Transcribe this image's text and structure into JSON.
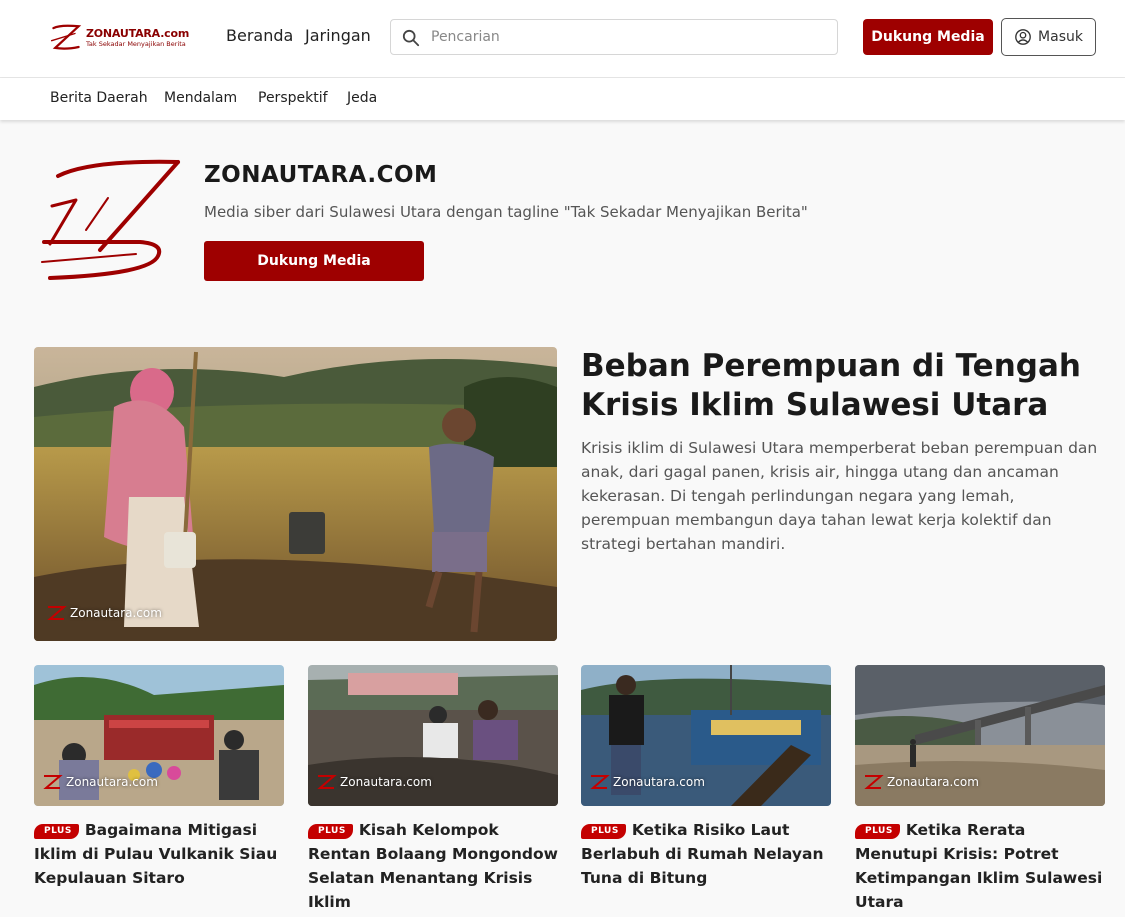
{
  "header": {
    "logo": {
      "name": "ZONAUTARA.com",
      "tagline": "Tak Sekadar Menyajikan Berita"
    },
    "nav": [
      {
        "label": "Beranda"
      },
      {
        "label": "Jaringan"
      }
    ],
    "search": {
      "placeholder": "Pencarian",
      "value": ""
    },
    "support_label": "Dukung Media",
    "login_label": "Masuk"
  },
  "subnav": [
    {
      "label": "Berita Daerah"
    },
    {
      "label": "Mendalam"
    },
    {
      "label": "Perspektif"
    },
    {
      "label": "Jeda"
    }
  ],
  "profile": {
    "title": "ZONAUTARA.COM",
    "description": "Media siber dari Sulawesi Utara dengan tagline \"Tak Sekadar Menyajikan Berita\"",
    "support_label": "Dukung Media"
  },
  "hero": {
    "title": "Beban Perempuan di Tengah Krisis Iklim Sulawesi Utara",
    "description": "Krisis iklim di Sulawesi Utara memperberat beban perempuan dan anak, dari gagal panen, krisis air, hingga utang dan ancaman kekerasan. Di tengah perlindungan negara yang lemah, perempuan membangun daya tahan lewat kerja kolektif dan strategi bertahan mandiri.",
    "watermark": "Zonautara.com"
  },
  "cards": [
    {
      "badge": "PLUS",
      "title": "Bagaimana Mitigasi Iklim di Pulau Vulkanik Siau Kepulauan Sitaro",
      "watermark": "Zonautara.com"
    },
    {
      "badge": "PLUS",
      "title": "Kisah Kelompok Rentan Bolaang Mongondow Selatan Menantang Krisis Iklim",
      "watermark": "Zonautara.com"
    },
    {
      "badge": "PLUS",
      "title": "Ketika Risiko Laut Berlabuh di Rumah Nelayan Tuna di Bitung",
      "watermark": "Zonautara.com"
    },
    {
      "badge": "PLUS",
      "title": "Ketika Rerata Menutupi Krisis: Potret Ketimpangan Iklim Sulawesi Utara",
      "watermark": "Zonautara.com"
    }
  ],
  "colors": {
    "brand": "#9e0000",
    "badge": "#c40000"
  },
  "icons": {
    "search": "search-icon",
    "user": "user-circle-icon",
    "logo": "z-logo-icon"
  }
}
